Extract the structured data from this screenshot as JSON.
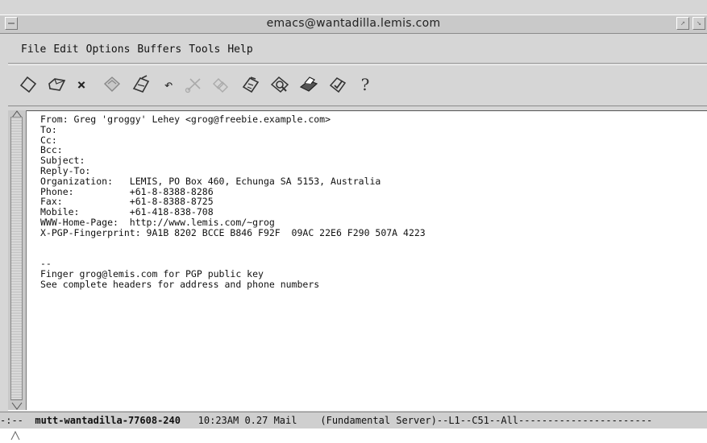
{
  "window": {
    "title": "emacs@wantadilla.lemis.com",
    "wm_buttons": {
      "right1": "↗",
      "right2": "↘"
    }
  },
  "menubar": {
    "items": [
      "File",
      "Edit",
      "Options",
      "Buffers",
      "Tools",
      "Help"
    ]
  },
  "toolbar": {
    "icons": [
      "open-file-icon",
      "open-directory-icon",
      "close-icon",
      "save-icon",
      "print-icon",
      "undo-icon",
      "cut-icon",
      "copy-icon",
      "paste-icon",
      "search-icon",
      "print-buffer-icon",
      "spell-check-icon",
      "help-icon"
    ],
    "close_glyph": "×",
    "undo_glyph": "↶",
    "help_glyph": "?"
  },
  "buffer": {
    "lines": [
      "From: Greg 'groggy' Lehey <grog@freebie.example.com>",
      "To:",
      "Cc:",
      "Bcc:",
      "Subject:",
      "Reply-To:",
      "Organization:   LEMIS, PO Box 460, Echunga SA 5153, Australia",
      "Phone:          +61-8-8388-8286",
      "Fax:            +61-8-8388-8725",
      "Mobile:         +61-418-838-708",
      "WWW-Home-Page:  http://www.lemis.com/~grog",
      "X-PGP-Fingerprint: 9A1B 8202 BCCE B846 F92F  09AC 22E6 F290 507A 4223",
      "",
      "",
      "--",
      "Finger grog@lemis.com for PGP public key",
      "See complete headers for address and phone numbers"
    ]
  },
  "modeline": {
    "prefix": "-:--  ",
    "buffer_name": "mutt-wantadilla-77608-240",
    "status": "   10:23AM 0.27 Mail    (Fundamental Server)--L1--C51--All-----------------------"
  }
}
